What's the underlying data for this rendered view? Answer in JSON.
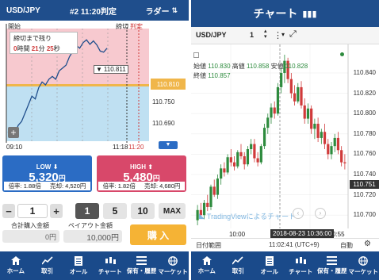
{
  "left": {
    "header": {
      "pair": "USD/JPY",
      "round": "#2 11:20判定",
      "mode": "ラダー"
    },
    "chart": {
      "start_label": "開始",
      "close_label": "締切",
      "judge_label": "判定",
      "countdown_title": "締切まで残り",
      "countdown": {
        "hours": "0",
        "h_unit": "時間",
        "minutes": "21",
        "m_unit": "分",
        "seconds": "25",
        "s_unit": "秒"
      },
      "current_price": "110.811",
      "levels": [
        "110.810",
        "110.750",
        "110.690"
      ],
      "time_start": "09:10",
      "time_close": "11:18",
      "time_judge": "11:20",
      "series": [
        110.655,
        110.66,
        110.652,
        110.668,
        110.675,
        110.69,
        110.705,
        110.72,
        110.715,
        110.735,
        110.745,
        110.74,
        110.75,
        110.755,
        110.75,
        110.765,
        110.77,
        110.775,
        110.79,
        110.8,
        110.81,
        110.805,
        110.815,
        110.82,
        110.812,
        110.818,
        110.811,
        110.8,
        110.798,
        110.805
      ]
    },
    "low": {
      "label": "LOW",
      "price": "5,320",
      "unit": "円",
      "odds": "倍率: 1.88倍",
      "sell": "売却: 4,520円"
    },
    "high": {
      "label": "HIGH",
      "price": "5,480",
      "unit": "円",
      "odds": "倍率: 1.82倍",
      "sell": "売却: 4,680円"
    },
    "order": {
      "minus": "−",
      "qty": "1",
      "plus": "+",
      "quick": [
        "1",
        "5",
        "10",
        "MAX"
      ],
      "total_label": "合計購入金額",
      "total_value": "0円",
      "payout_label": "ペイアウト金額",
      "payout_value": "10,000円",
      "buy_label": "購 入"
    },
    "nav": [
      "ホーム",
      "取引",
      "オール",
      "チャート",
      "保有・履歴",
      "マーケット"
    ]
  },
  "right": {
    "header": {
      "title": "チャート"
    },
    "toolbar": {
      "pair": "USD/JPY",
      "interval": "1"
    },
    "ohlc": {
      "open_label": "始値",
      "open": "110.830",
      "high_label": "高値",
      "high": "110.858",
      "low_label": "安値",
      "low": "110.828",
      "close_label": "終値",
      "close": "110.857"
    },
    "axis": {
      "y": [
        "110.840",
        "110.820",
        "110.800",
        "110.780",
        "110.760",
        "110.740",
        "110.720",
        "110.700"
      ],
      "current": "110.751",
      "x_label": "10:00",
      "x_label2": "0:55",
      "crosshair": "2018-08-23 10:36:00"
    },
    "watermark": "TradingViewによるチャート",
    "footer": {
      "range": "日付範囲",
      "time": "11:02:41 (UTC+9)",
      "mode": "自動"
    },
    "candles": [
      [
        110.695,
        110.71,
        110.69,
        110.705
      ],
      [
        110.705,
        110.712,
        110.698,
        110.7
      ],
      [
        110.7,
        110.715,
        110.696,
        110.712
      ],
      [
        110.712,
        110.72,
        110.704,
        110.708
      ],
      [
        110.708,
        110.73,
        110.705,
        110.728
      ],
      [
        110.728,
        110.735,
        110.718,
        110.72
      ],
      [
        110.72,
        110.74,
        110.716,
        110.736
      ],
      [
        110.736,
        110.75,
        110.73,
        110.746
      ],
      [
        110.746,
        110.752,
        110.738,
        110.742
      ],
      [
        110.742,
        110.76,
        110.74,
        110.757
      ],
      [
        110.757,
        110.765,
        110.748,
        110.752
      ],
      [
        110.752,
        110.758,
        110.744,
        110.748
      ],
      [
        110.748,
        110.764,
        110.746,
        110.762
      ],
      [
        110.762,
        110.77,
        110.755,
        110.758
      ],
      [
        110.758,
        110.762,
        110.745,
        110.75
      ],
      [
        110.75,
        110.768,
        110.748,
        110.765
      ],
      [
        110.765,
        110.775,
        110.76,
        110.77
      ],
      [
        110.77,
        110.775,
        110.752,
        110.756
      ],
      [
        110.756,
        110.762,
        110.748,
        110.752
      ],
      [
        110.752,
        110.77,
        110.75,
        110.768
      ],
      [
        110.768,
        110.79,
        110.765,
        110.786
      ],
      [
        110.786,
        110.8,
        110.78,
        110.796
      ],
      [
        110.796,
        110.81,
        110.79,
        110.806
      ],
      [
        110.806,
        110.812,
        110.795,
        110.8
      ],
      [
        110.8,
        110.83,
        110.798,
        110.826
      ],
      [
        110.826,
        110.845,
        110.82,
        110.84
      ],
      [
        110.84,
        110.858,
        110.83,
        110.852
      ],
      [
        110.852,
        110.855,
        110.83,
        110.834
      ],
      [
        110.834,
        110.84,
        110.815,
        110.82
      ],
      [
        110.82,
        110.828,
        110.808,
        110.812
      ],
      [
        110.812,
        110.83,
        110.81,
        110.826
      ],
      [
        110.826,
        110.832,
        110.805,
        110.808
      ],
      [
        110.808,
        110.815,
        110.79,
        110.795
      ],
      [
        110.795,
        110.81,
        110.79,
        110.805
      ],
      [
        110.805,
        110.808,
        110.78,
        110.785
      ],
      [
        110.785,
        110.795,
        110.775,
        110.79
      ],
      [
        110.79,
        110.796,
        110.772,
        110.776
      ],
      [
        110.776,
        110.785,
        110.77,
        110.782
      ],
      [
        110.782,
        110.79,
        110.765,
        110.77
      ],
      [
        110.77,
        110.775,
        110.755,
        110.76
      ],
      [
        110.76,
        110.772,
        110.755,
        110.768
      ],
      [
        110.768,
        110.78,
        110.762,
        110.776
      ],
      [
        110.776,
        110.782,
        110.76,
        110.764
      ],
      [
        110.764,
        110.768,
        110.748,
        110.752
      ],
      [
        110.752,
        110.76,
        110.745,
        110.751
      ]
    ]
  },
  "colors": {
    "navy": "#1f4e8c",
    "low_blue": "#2b6cc4",
    "high_pink": "#d8486a",
    "up": "#2e8b3e",
    "down": "#d03a3a",
    "buy": "#f5b335",
    "price_tag": "#f0b64a"
  }
}
